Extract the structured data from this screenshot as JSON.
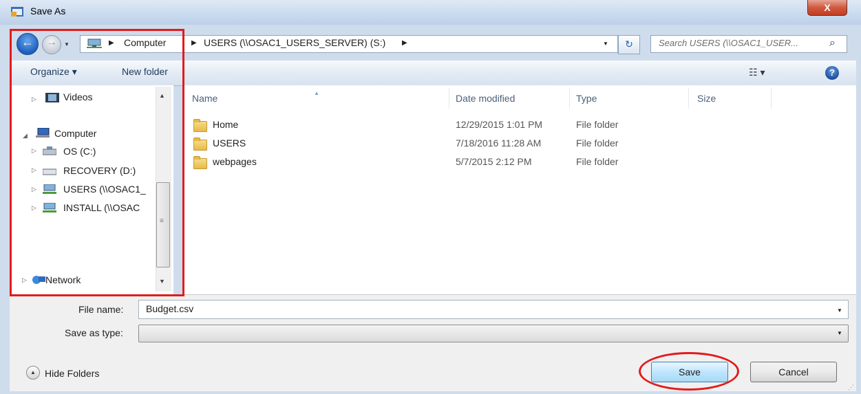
{
  "window": {
    "title": "Save As",
    "close_label": "X"
  },
  "address_bar": {
    "crumbs": [
      "Computer",
      "USERS (\\\\OSAC1_USERS_SERVER) (S:)"
    ],
    "search_placeholder": "Search USERS (\\\\OSAC1_USER..."
  },
  "toolbar": {
    "organize_label": "Organize ▾",
    "new_folder_label": "New folder"
  },
  "nav_pane": {
    "items": [
      {
        "label": "Videos",
        "icon": "video-icon"
      },
      {
        "label": "Computer",
        "icon": "computer-icon"
      },
      {
        "label": "OS (C:)",
        "icon": "drive-icon"
      },
      {
        "label": "RECOVERY (D:)",
        "icon": "drive-icon"
      },
      {
        "label": "USERS (\\\\OSAC1_",
        "icon": "network-drive-icon"
      },
      {
        "label": "INSTALL (\\\\OSAC",
        "icon": "network-drive-icon"
      },
      {
        "label": "Network",
        "icon": "network-icon"
      }
    ]
  },
  "file_list": {
    "columns": [
      "Name",
      "Date modified",
      "Type",
      "Size"
    ],
    "rows": [
      {
        "name": "Home",
        "date": "12/29/2015 1:01 PM",
        "type": "File folder"
      },
      {
        "name": "USERS",
        "date": "7/18/2016 11:28 AM",
        "type": "File folder"
      },
      {
        "name": "webpages",
        "date": "5/7/2015 2:12 PM",
        "type": "File folder"
      }
    ]
  },
  "form": {
    "file_name_label": "File name:",
    "file_name_value": "Budget.csv",
    "save_as_type_label": "Save as type:",
    "save_as_type_value": ""
  },
  "footer": {
    "hide_folders_label": "Hide Folders",
    "save_label": "Save",
    "cancel_label": "Cancel"
  },
  "colors": {
    "annotation": "#e21b1b",
    "frame": "#cfdcec",
    "save_button": "#bee6fd"
  }
}
